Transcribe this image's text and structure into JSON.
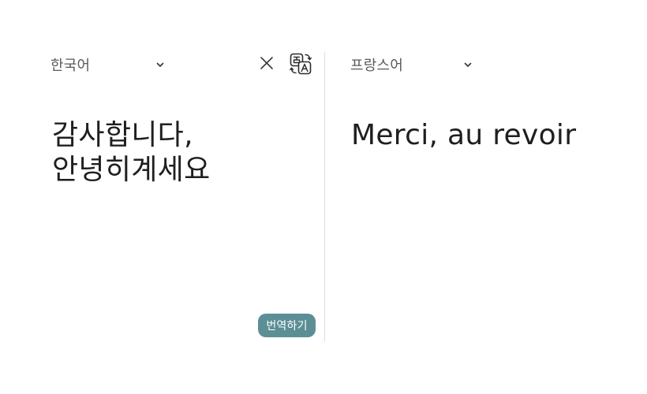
{
  "source": {
    "language_label": "한국어",
    "text": "감사합니다,\n안녕히계세요"
  },
  "target": {
    "language_label": "프랑스어",
    "text": "Merci, au revoir"
  },
  "actions": {
    "translate_label": "번역하기"
  },
  "icons": {
    "clear": "close-icon",
    "swap": "translate-swap-icon",
    "dropdown": "chevron-down-icon"
  },
  "colors": {
    "accent": "#5c8e96",
    "divider": "#dedede",
    "text": "#1f1f1f",
    "muted": "#5a5a5a"
  }
}
